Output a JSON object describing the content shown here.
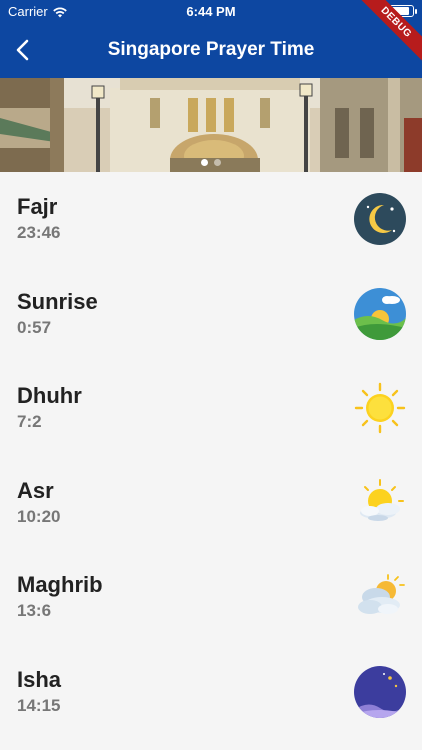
{
  "status": {
    "carrier": "Carrier",
    "time": "6:44 PM",
    "debug": "DEBUG"
  },
  "header": {
    "title": "Singapore Prayer Time",
    "back_icon": "chevron-left-icon"
  },
  "banner": {
    "page_count": 2,
    "active_page": 1
  },
  "prayers": [
    {
      "name": "Fajr",
      "time": "23:46",
      "icon": "crescent-moon-night-icon"
    },
    {
      "name": "Sunrise",
      "time": "0:57",
      "icon": "sunrise-landscape-icon"
    },
    {
      "name": "Dhuhr",
      "time": "7:2",
      "icon": "sun-icon"
    },
    {
      "name": "Asr",
      "time": "10:20",
      "icon": "sun-behind-cloud-icon"
    },
    {
      "name": "Maghrib",
      "time": "13:6",
      "icon": "cloudy-sun-icon"
    },
    {
      "name": "Isha",
      "time": "14:15",
      "icon": "night-moon-stars-icon"
    }
  ],
  "colors": {
    "app_bar": "#0d47a1",
    "background": "#f5f5f5",
    "debug_banner": "#b71c1c"
  }
}
